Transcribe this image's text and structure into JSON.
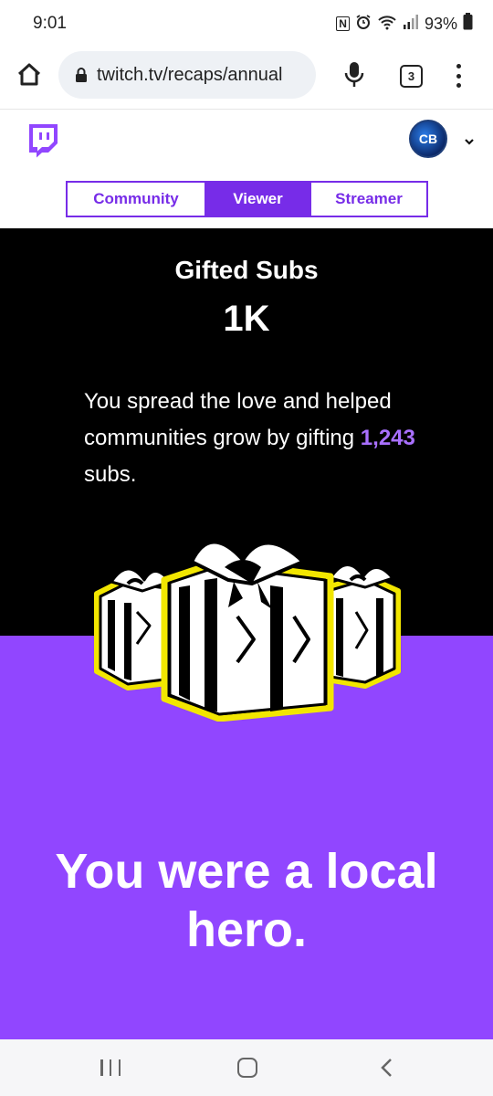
{
  "status_bar": {
    "time": "9:01",
    "nfc_glyph": "N",
    "battery": "93%",
    "icons": [
      "nfc-icon",
      "alarm-icon",
      "wifi-icon",
      "signal-icon",
      "battery-icon"
    ]
  },
  "browser": {
    "url": "twitch.tv/recaps/annual",
    "tab_count": "3",
    "icons": [
      "home-icon",
      "lock-icon",
      "mic-icon",
      "tabs-icon",
      "more-vert-icon"
    ]
  },
  "header": {
    "logo_icon": "twitch-logo-icon",
    "avatar_initials": "CB",
    "caret_icon": "chevron-down-icon",
    "tabs": [
      {
        "label": "Community",
        "active": false
      },
      {
        "label": "Viewer",
        "active": true
      },
      {
        "label": "Streamer",
        "active": false
      }
    ]
  },
  "recap": {
    "title": "Gifted Subs",
    "value": "1K",
    "description_before": "You spread the love and helped communities grow by gifting ",
    "highlight": "1,243",
    "description_after": " subs.",
    "illustration": "gift-boxes-illustration"
  },
  "hero": {
    "line1": "You were a local",
    "line2": "hero."
  },
  "nav": {
    "icons": [
      "recents-icon",
      "home-nav-icon",
      "back-icon"
    ]
  },
  "colors": {
    "brand_purple": "#9146ff",
    "accent_purple": "#772ce8",
    "highlight_purple": "#a970ff",
    "gift_outline_yellow": "#f2e600"
  }
}
